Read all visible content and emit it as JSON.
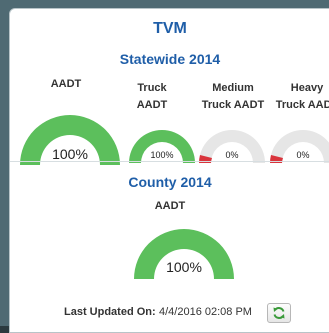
{
  "panel": {
    "title": "TVM",
    "close_label": "×"
  },
  "statewide": {
    "title": "Statewide 2014",
    "gauges": [
      {
        "label_line1": "AADT",
        "label_line2": "",
        "percent": 100,
        "percent_label": "100%"
      },
      {
        "label_line1": "Truck",
        "label_line2": "AADT",
        "percent": 100,
        "percent_label": "100%"
      },
      {
        "label_line1": "Medium",
        "label_line2": "Truck AADT",
        "percent": 0,
        "percent_label": "0%"
      },
      {
        "label_line1": "Heavy",
        "label_line2": "Truck AADT",
        "percent": 0,
        "percent_label": "0%"
      }
    ]
  },
  "county": {
    "title": "County 2014",
    "gauges": [
      {
        "label_line1": "AADT",
        "percent": 100,
        "percent_label": "100%"
      }
    ]
  },
  "footer": {
    "last_updated_label": "Last Updated On:",
    "last_updated_value": "4/4/2016 02:08 PM",
    "refresh_icon": "refresh-icon"
  },
  "colors": {
    "title_blue": "#1f5ea8",
    "gauge_green": "#5cbf5c",
    "gauge_track": "#e6e6e6",
    "gauge_zero_red": "#d9343c",
    "refresh_green": "#3a9a3a"
  }
}
